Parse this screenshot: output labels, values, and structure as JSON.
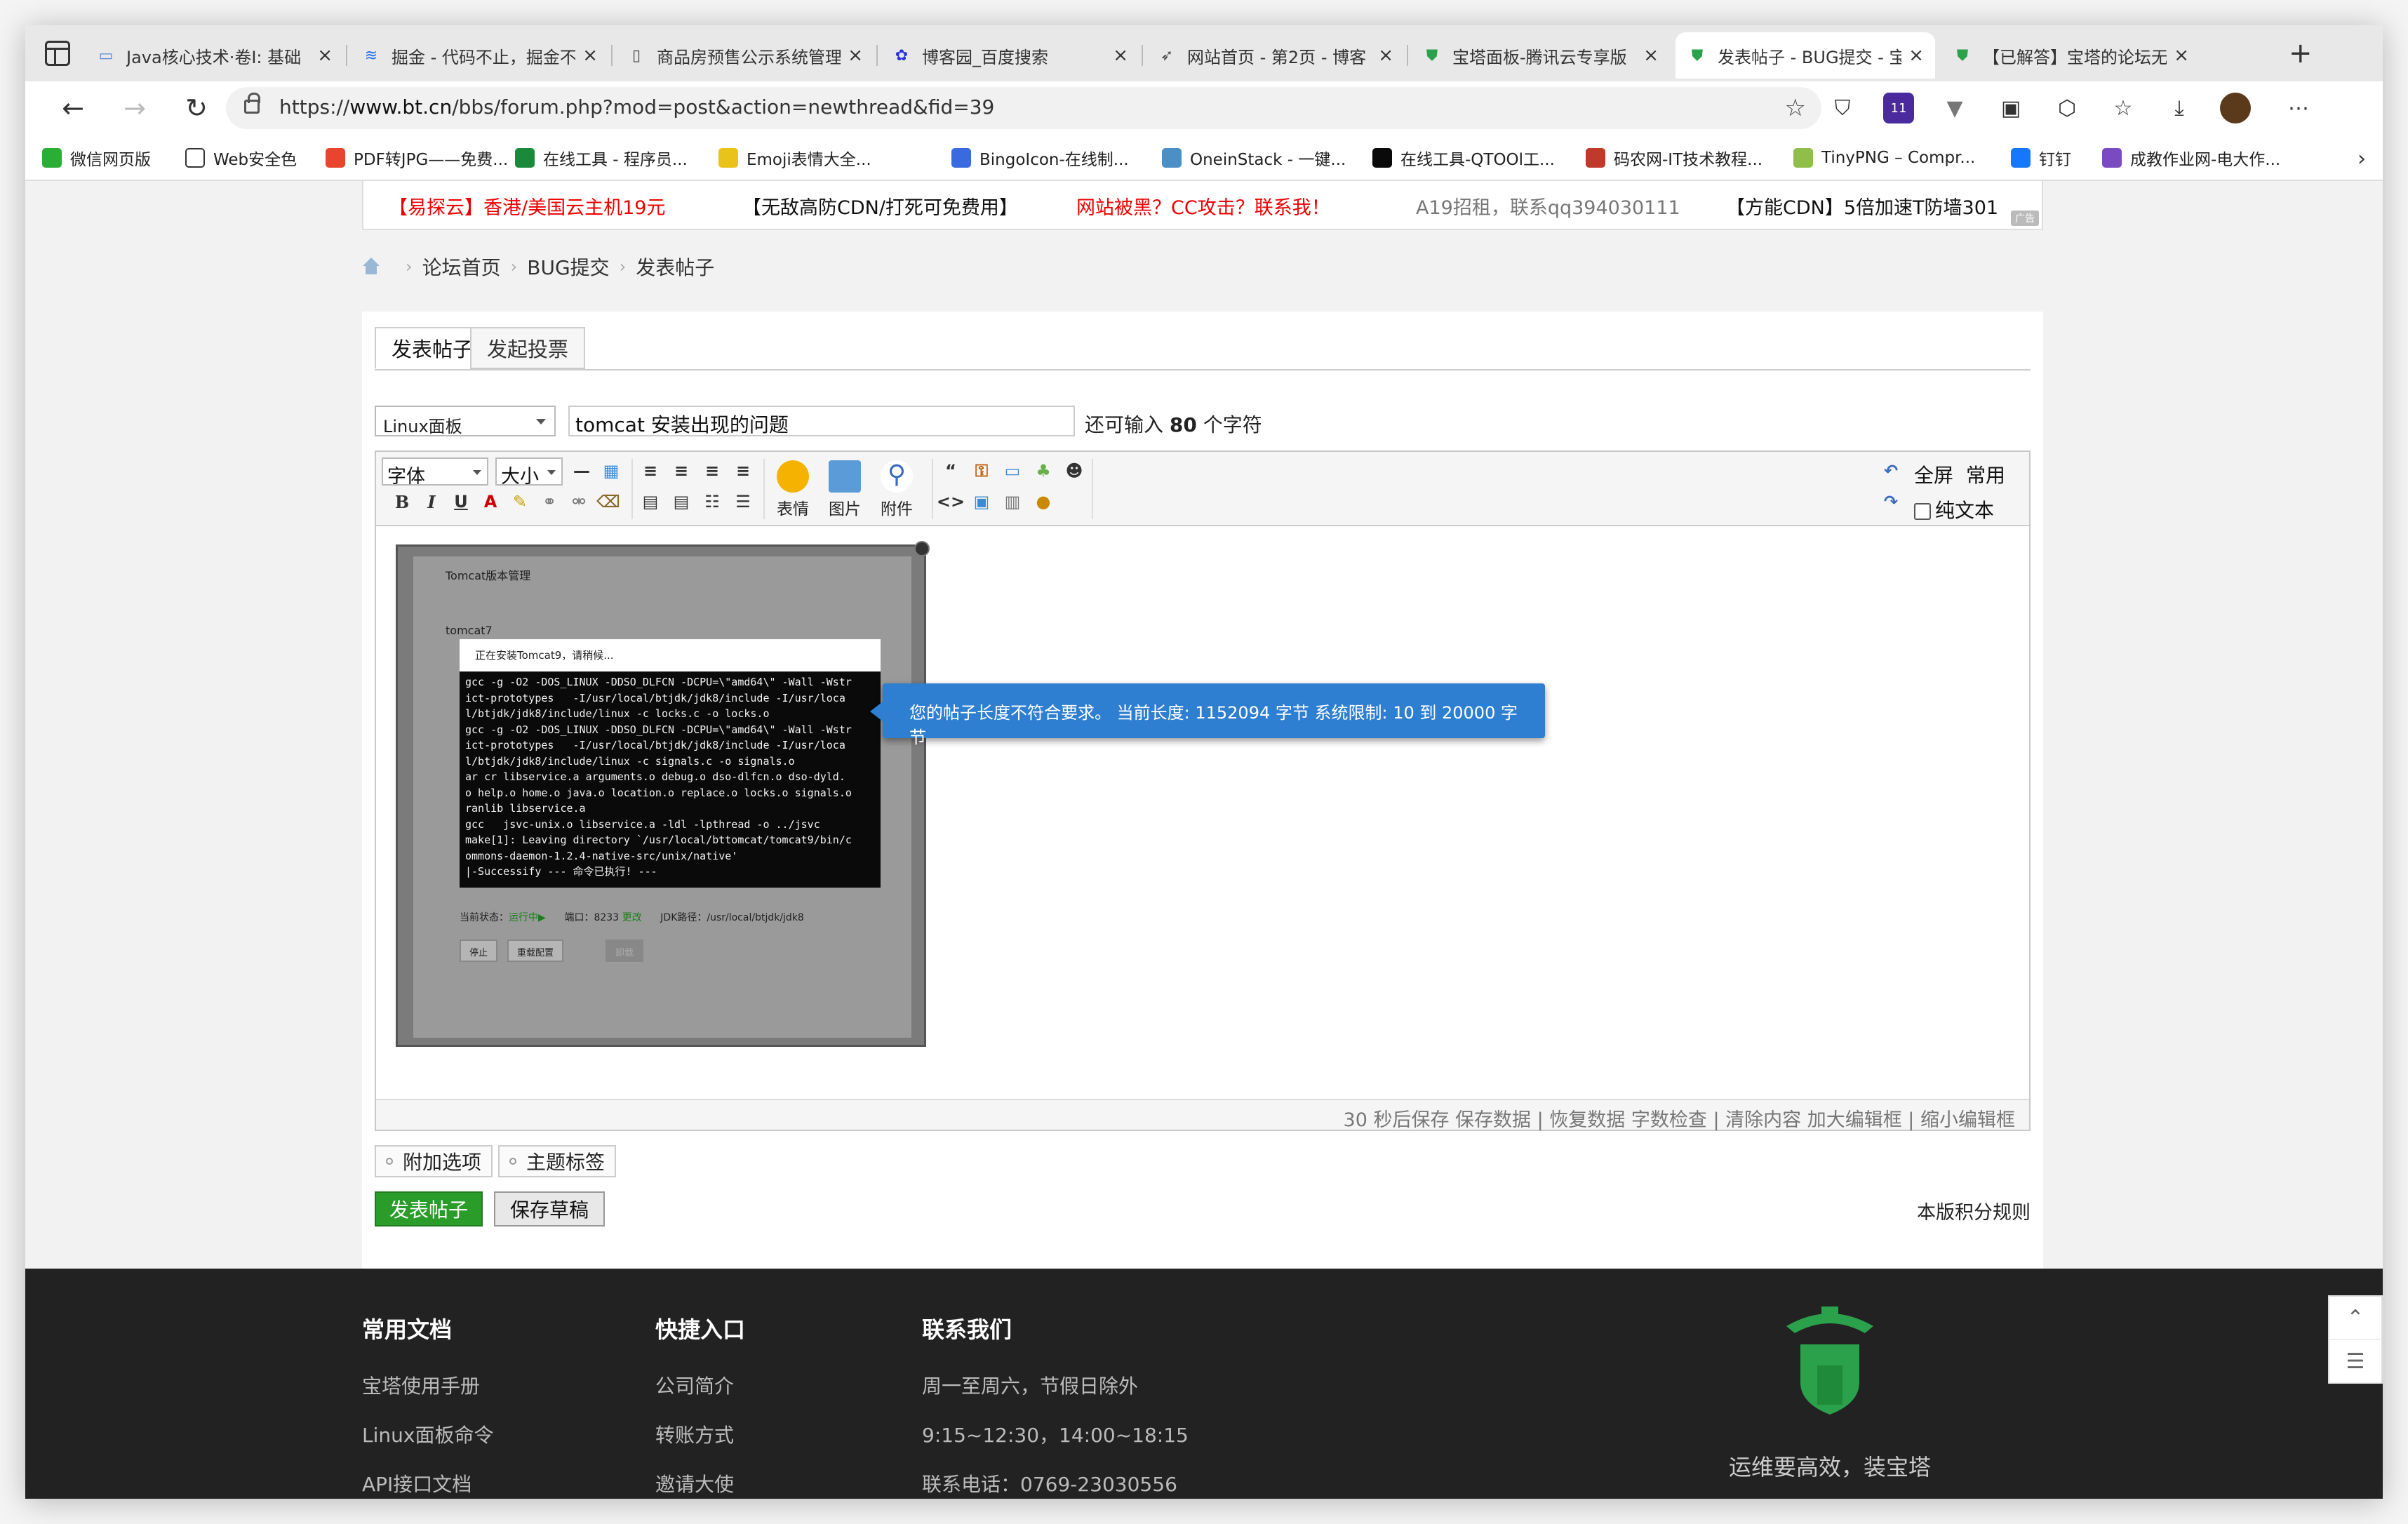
{
  "tabs": [
    {
      "title": "Java核心技术·卷I: 基础",
      "icon": "laptop-icon"
    },
    {
      "title": "掘金 - 代码不止，掘金不停",
      "icon": "juejin-icon"
    },
    {
      "title": "商品房预售公示系统管理",
      "icon": "document-icon"
    },
    {
      "title": "博客园_百度搜索",
      "icon": "baidu-paw-icon"
    },
    {
      "title": "网站首页 - 第2页 - 博客",
      "icon": "rocket-icon"
    },
    {
      "title": "宝塔面板-腾讯云专享版",
      "icon": "bt-shield-icon"
    },
    {
      "title": "发表帖子 - BUG提交 - 宝",
      "icon": "bt-shield-icon"
    },
    {
      "title": "【已解答】宝塔的论坛无",
      "icon": "bt-shield-icon"
    }
  ],
  "nav": {
    "url_prefix": "https://",
    "url_host": "www.bt.cn",
    "url_path": "/bbs/forum.php?mod=post&action=newthread&fid=39",
    "badge": "11"
  },
  "bookmarks": [
    {
      "label": "微信网页版",
      "color": "#2aae35"
    },
    {
      "label": "Web安全色",
      "color": "#ffffff"
    },
    {
      "label": "PDF转JPG——免费...",
      "color": "#e8442e"
    },
    {
      "label": "在线工具 - 程序员...",
      "color": "#1a8a3a"
    },
    {
      "label": "Emoji表情大全...",
      "color": "#e9c21a"
    },
    {
      "label": "BingoIcon-在线制...",
      "color": "#3a6ae0"
    },
    {
      "label": "OneinStack - 一键...",
      "color": "#4a90c6"
    },
    {
      "label": "在线工具-QTOOl工...",
      "color": "#0a0a0a"
    },
    {
      "label": "码农网-IT技术教程...",
      "color": "#c0392b"
    },
    {
      "label": "TinyPNG – Compr...",
      "color": "#8fbf4a"
    },
    {
      "label": "钉钉",
      "color": "#1677ff"
    },
    {
      "label": "成教作业网-电大作...",
      "color": "#7a4ac2"
    }
  ],
  "ads": [
    {
      "text": "【易探云】香港/美国云主机19元",
      "style": "red"
    },
    {
      "text": "【无敌高防CDN/打死可免费用】",
      "style": "blk"
    },
    {
      "text": "网站被黑？CC攻击？联系我！",
      "style": "red"
    },
    {
      "text": "A19招租，联系qq394030111",
      "style": "gray"
    },
    {
      "text": "【方能CDN】5倍加速T防墙301",
      "style": "blk"
    }
  ],
  "ad_tag": "广告",
  "breadcrumb": [
    "论坛首页",
    "BUG提交",
    "发表帖子"
  ],
  "post_tabs": [
    "发表帖子",
    "发起投票"
  ],
  "form": {
    "category": "Linux面板",
    "title_value": "tomcat 安装出现的问题",
    "remain_prefix": "还可输入",
    "remain_count": "80",
    "remain_suffix": "个字符"
  },
  "toolbar": {
    "font": "字体",
    "size": "大小",
    "emoji": "表情",
    "image": "图片",
    "attach": "附件",
    "fullscreen": "全屏",
    "common": "常用",
    "plaintext": "纯文本"
  },
  "screenshot": {
    "title": "Tomcat版本管理",
    "version": "tomcat7",
    "modal": "正在安装Tomcat9，请稍候...",
    "terminal": [
      "gcc -g -O2 -DOS_LINUX -DDSO_DLFCN -DCPU=\\\"amd64\\\" -Wall -Wstr",
      "ict-prototypes   -I/usr/local/btjdk/jdk8/include -I/usr/loca",
      "l/btjdk/jdk8/include/linux -c locks.c -o locks.o",
      "gcc -g -O2 -DOS_LINUX -DDSO_DLFCN -DCPU=\\\"amd64\\\" -Wall -Wstr",
      "ict-prototypes   -I/usr/local/btjdk/jdk8/include -I/usr/loca",
      "l/btjdk/jdk8/include/linux -c signals.c -o signals.o",
      "ar cr libservice.a arguments.o debug.o dso-dlfcn.o dso-dyld.",
      "o help.o home.o java.o location.o replace.o locks.o signals.o",
      "ranlib libservice.a",
      "gcc   jsvc-unix.o libservice.a -ldl -lpthread -o ../jsvc",
      "make[1]: Leaving directory `/usr/local/bttomcat/tomcat9/bin/c",
      "ommons-daemon-1.2.4-native-src/unix/native'",
      "|-Successify --- 命令已执行! ---"
    ],
    "status_label": "当前状态：",
    "status_value": "运行中▶",
    "port_label": "端口：",
    "port_value": "8233",
    "port_edit": "更改",
    "jdk_label": "JDK路径：",
    "jdk_value": "/usr/local/btjdk/jdk8",
    "btn_stop": "停止",
    "btn_reload": "重载配置",
    "btn_uninstall": "卸载"
  },
  "tooltip": "您的帖子长度不符合要求。 当前长度: 1152094 字节 系统限制: 10 到 20000 字节",
  "editor_status": "30 秒后保存 保存数据 | 恢复数据    字数检查 | 清除内容    加大编辑框 | 缩小编辑框",
  "options": [
    "附加选项",
    "主题标签"
  ],
  "submit": "发表帖子",
  "draft": "保存草稿",
  "rules": "本版积分规则",
  "footer": {
    "col1_title": "常用文档",
    "col1": [
      "宝塔使用手册",
      "Linux面板命令",
      "API接口文档"
    ],
    "col2_title": "快捷入口",
    "col2": [
      "公司简介",
      "转账方式",
      "邀请大使"
    ],
    "col3_title": "联系我们",
    "col3": [
      "周一至周六，节假日除外",
      "9:15~12:30，14:00~18:15",
      "联系电话：0769-23030556"
    ],
    "slogan": "运维要高效，装宝塔"
  }
}
